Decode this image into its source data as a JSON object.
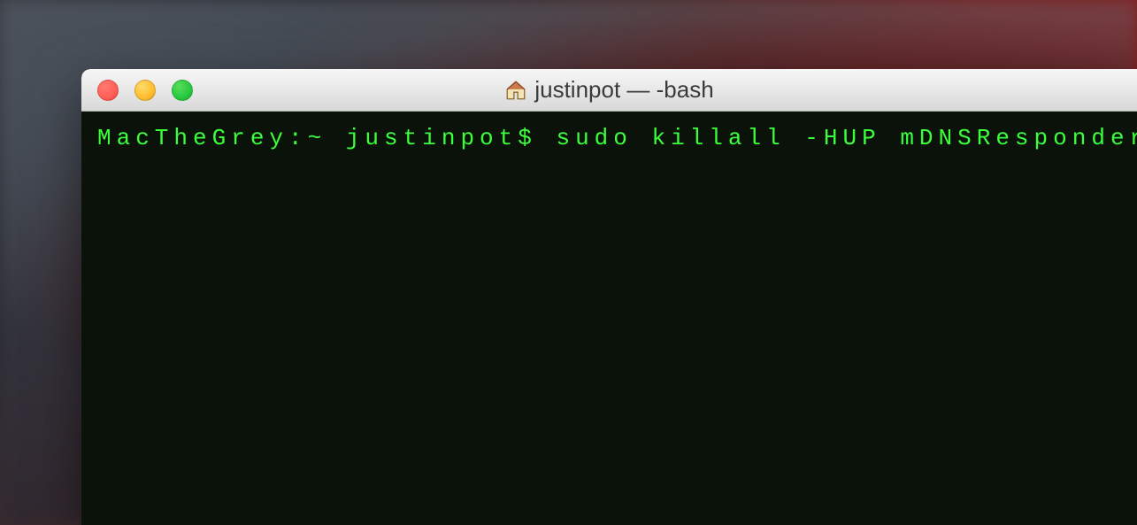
{
  "window": {
    "title": "justinpot — -bash"
  },
  "terminal": {
    "prompt": "MacTheGrey:~ justinpot$ ",
    "command": "sudo killall -HUP mDNSResponder"
  }
}
